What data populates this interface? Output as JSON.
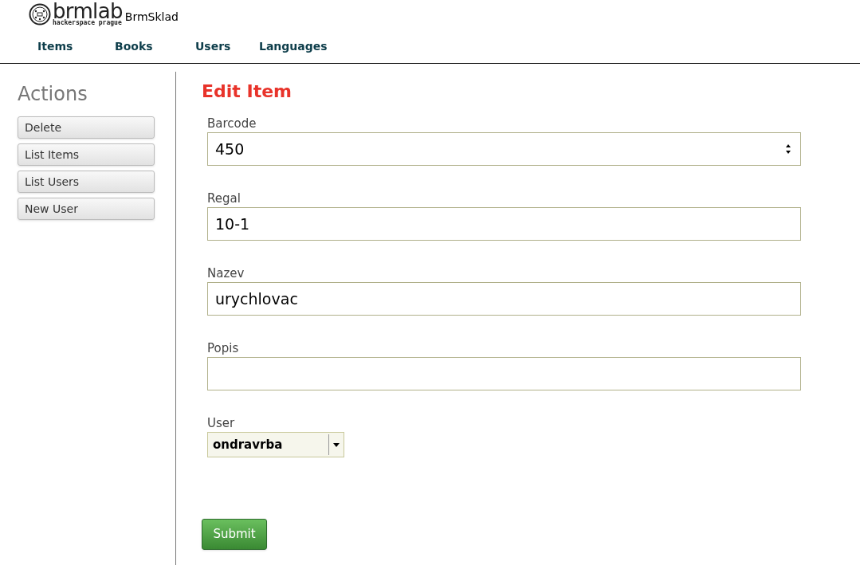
{
  "header": {
    "logo_text": "brmlab",
    "logo_subtitle": "hackerspace prague",
    "app_name": "BrmSklad"
  },
  "nav": [
    {
      "label": "Items"
    },
    {
      "label": "Books"
    },
    {
      "label": "Users"
    },
    {
      "label": "Languages"
    }
  ],
  "sidebar": {
    "title": "Actions",
    "buttons": [
      "Delete",
      "List Items",
      "List Users",
      "New User"
    ]
  },
  "form": {
    "title": "Edit Item",
    "fields": [
      {
        "label": "Barcode",
        "kind": "number",
        "value": "450"
      },
      {
        "label": "Regal",
        "kind": "text",
        "value": "10-1"
      },
      {
        "label": "Nazev",
        "kind": "text",
        "value": "urychlovac"
      },
      {
        "label": "Popis",
        "kind": "text"
      },
      {
        "label": "User",
        "kind": "select",
        "value": "ondravrba"
      }
    ],
    "submit": "Submit"
  }
}
